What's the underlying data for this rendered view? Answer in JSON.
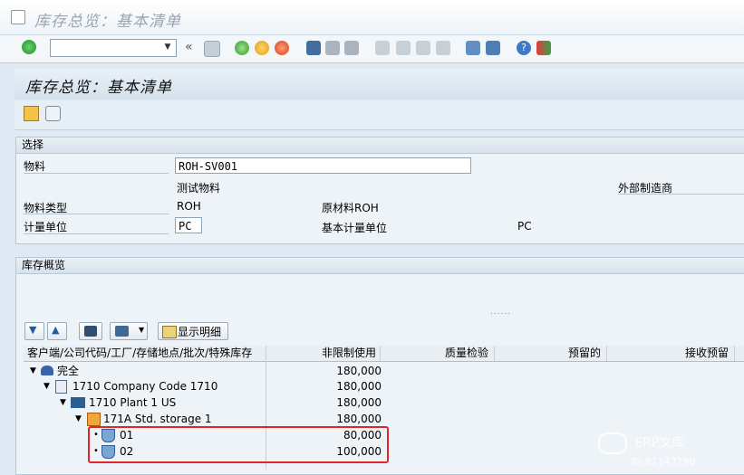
{
  "window": {
    "title": "库存总览：基本清单"
  },
  "toolbar": {
    "command_field": "",
    "icons": [
      "enter-icon",
      "back-double-icon",
      "save-icon",
      "back-icon",
      "exit-icon",
      "cancel-icon",
      "print-icon",
      "find-icon",
      "find-next-icon",
      "first-page-icon",
      "prev-page-icon",
      "next-page-icon",
      "last-page-icon",
      "new-session-icon",
      "shortcut-icon",
      "help-icon",
      "customize-icon"
    ]
  },
  "page": {
    "title": "库存总览：基本清单"
  },
  "selection": {
    "section_label": "选择",
    "material_label": "物料",
    "material_value": "ROH-SV001",
    "material_desc": "测试物料",
    "mfr_label": "外部制造商",
    "material_type_label": "物料类型",
    "material_type_value": "ROH",
    "material_type_desc": "原材料ROH",
    "uom_label": "计量单位",
    "uom_value": "PC",
    "base_uom_label": "基本计量单位",
    "base_uom_value": "PC"
  },
  "overview": {
    "section_label": "库存概览",
    "detail_button": "显示明细",
    "splitter": "......",
    "columns": [
      "客户端/公司代码/工厂/存储地点/批次/特殊库存",
      "非限制使用",
      "质量检验",
      "预留的",
      "接收预留"
    ],
    "rows": [
      {
        "label": "完全",
        "unrestricted": "180,000",
        "icon": "client-icon"
      },
      {
        "label": "1710 Company Code 1710",
        "unrestricted": "180,000",
        "icon": "company-icon"
      },
      {
        "label": "1710 Plant 1 US",
        "unrestricted": "180,000",
        "icon": "plant-icon"
      },
      {
        "label": "171A Std. storage 1",
        "unrestricted": "180,000",
        "icon": "storage-icon"
      },
      {
        "label": "01",
        "unrestricted": "80,000",
        "icon": "batch-icon"
      },
      {
        "label": "02",
        "unrestricted": "100,000",
        "icon": "batch-icon"
      }
    ]
  },
  "watermark": {
    "name": "ERP文库",
    "id": "ID:82143790"
  }
}
